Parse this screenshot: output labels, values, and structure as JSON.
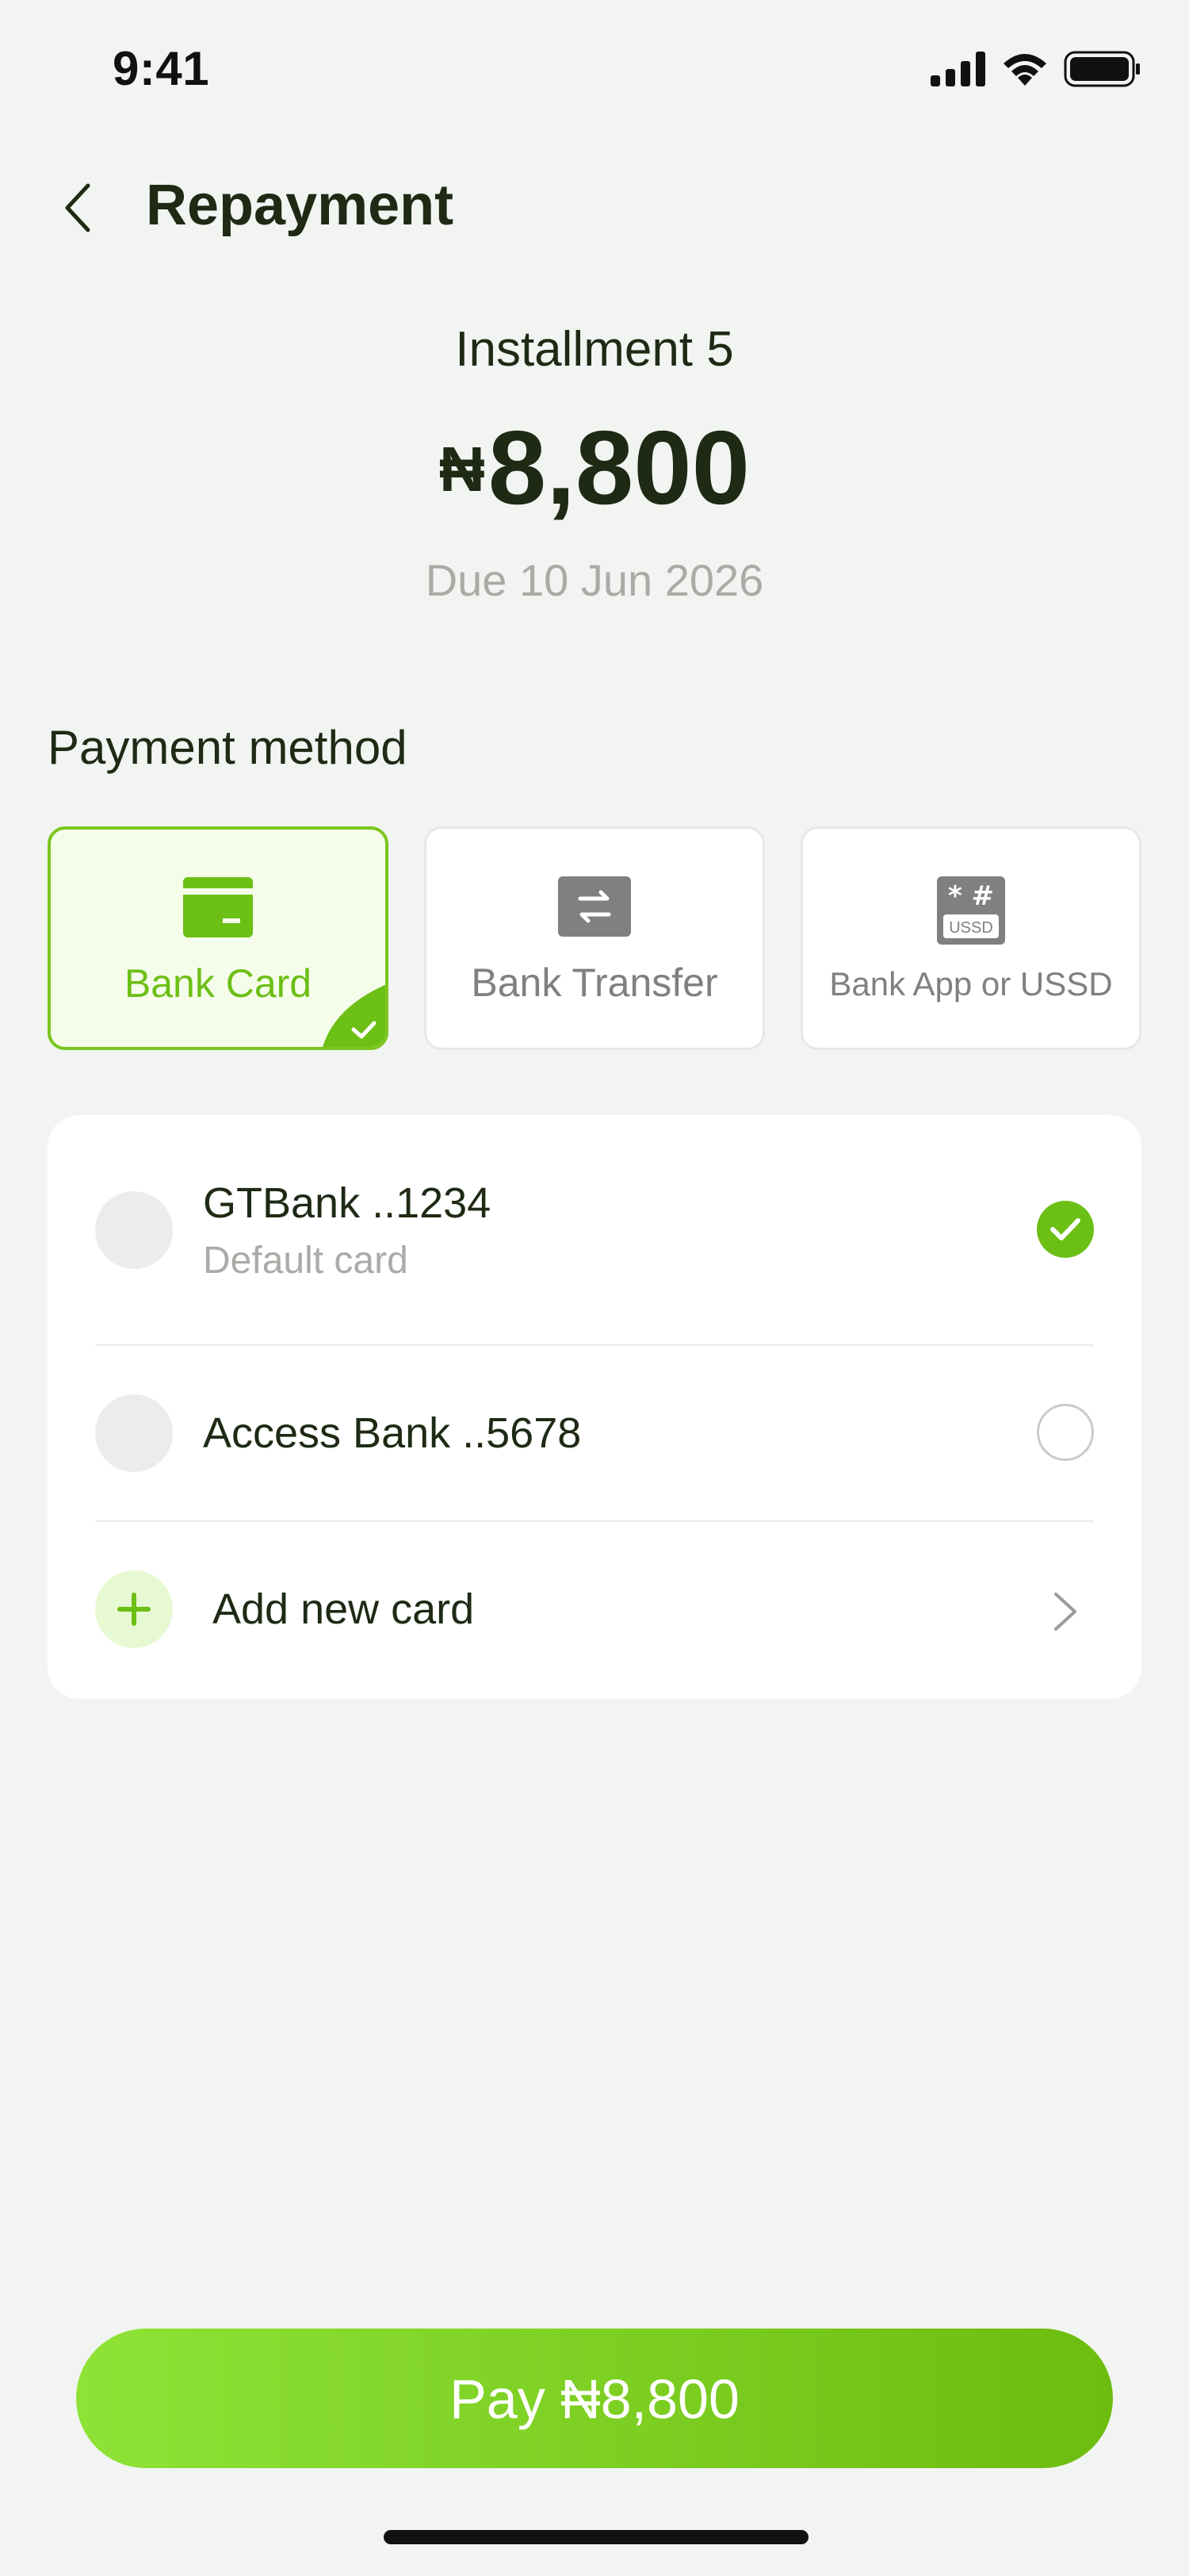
{
  "status_bar": {
    "time": "9:41",
    "icons": [
      "cellular-signal-icon",
      "wifi-icon",
      "battery-icon"
    ]
  },
  "header": {
    "back_icon": "chevron-left-icon",
    "title": "Repayment"
  },
  "summary": {
    "installment_label": "Installment 5",
    "currency_symbol": "₦",
    "amount": "8,800",
    "due_date": "Due 10 Jun 2026"
  },
  "payment_method": {
    "section_title": "Payment method",
    "options": [
      {
        "label": "Bank Card",
        "icon": "credit-card-icon",
        "selected": true
      },
      {
        "label": "Bank Transfer",
        "icon": "transfer-arrows-icon",
        "selected": false
      },
      {
        "label": "Bank App or USSD",
        "icon": "ussd-keypad-icon",
        "selected": false
      }
    ]
  },
  "cards": {
    "items": [
      {
        "name": "GTBank ..1234",
        "subtitle": "Default card",
        "selected": true
      },
      {
        "name": "Access Bank ..5678",
        "subtitle": "",
        "selected": false
      }
    ],
    "add_label": "Add new card"
  },
  "pay_button": {
    "label": "Pay ₦8,800"
  },
  "colors": {
    "accent": "#6cbf15",
    "accent_light": "#f5fdea",
    "background": "#f2f4f2",
    "text_primary": "#1e2a14",
    "text_muted": "#a9aca6"
  }
}
